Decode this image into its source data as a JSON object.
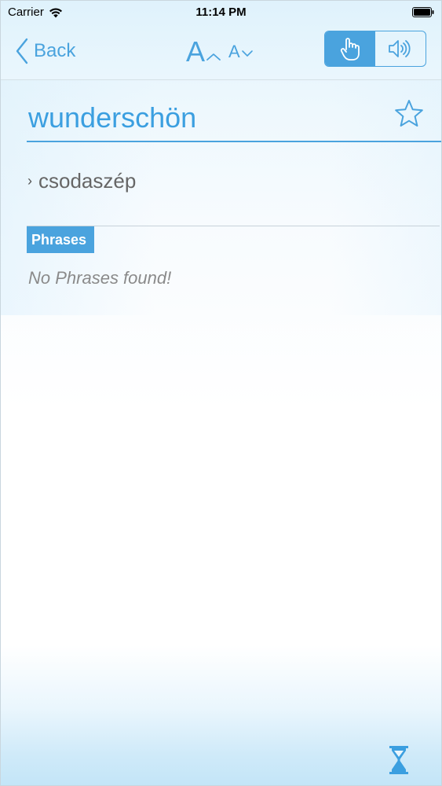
{
  "status_bar": {
    "carrier": "Carrier",
    "time": "11:14 PM"
  },
  "nav": {
    "back_label": "Back",
    "font_increase_label": "A",
    "font_decrease_label": "A",
    "mode_selected": "touch"
  },
  "entry": {
    "headword": "wunderschön",
    "translations": [
      {
        "bullet": "›",
        "text": "csodaszép"
      }
    ]
  },
  "phrases": {
    "header": "Phrases",
    "empty_message": "No Phrases found!"
  },
  "icons": {
    "wifi": "wifi-icon",
    "battery": "battery-icon",
    "back": "chevron-left-icon",
    "touch": "hand-pointer-icon",
    "speaker": "speaker-icon",
    "favorite": "star-outline-icon",
    "loading": "hourglass-icon"
  },
  "colors": {
    "accent": "#4aa3de",
    "headword": "#3b9fe0",
    "translation_text": "#666666",
    "empty_text": "#8a8a8a"
  }
}
